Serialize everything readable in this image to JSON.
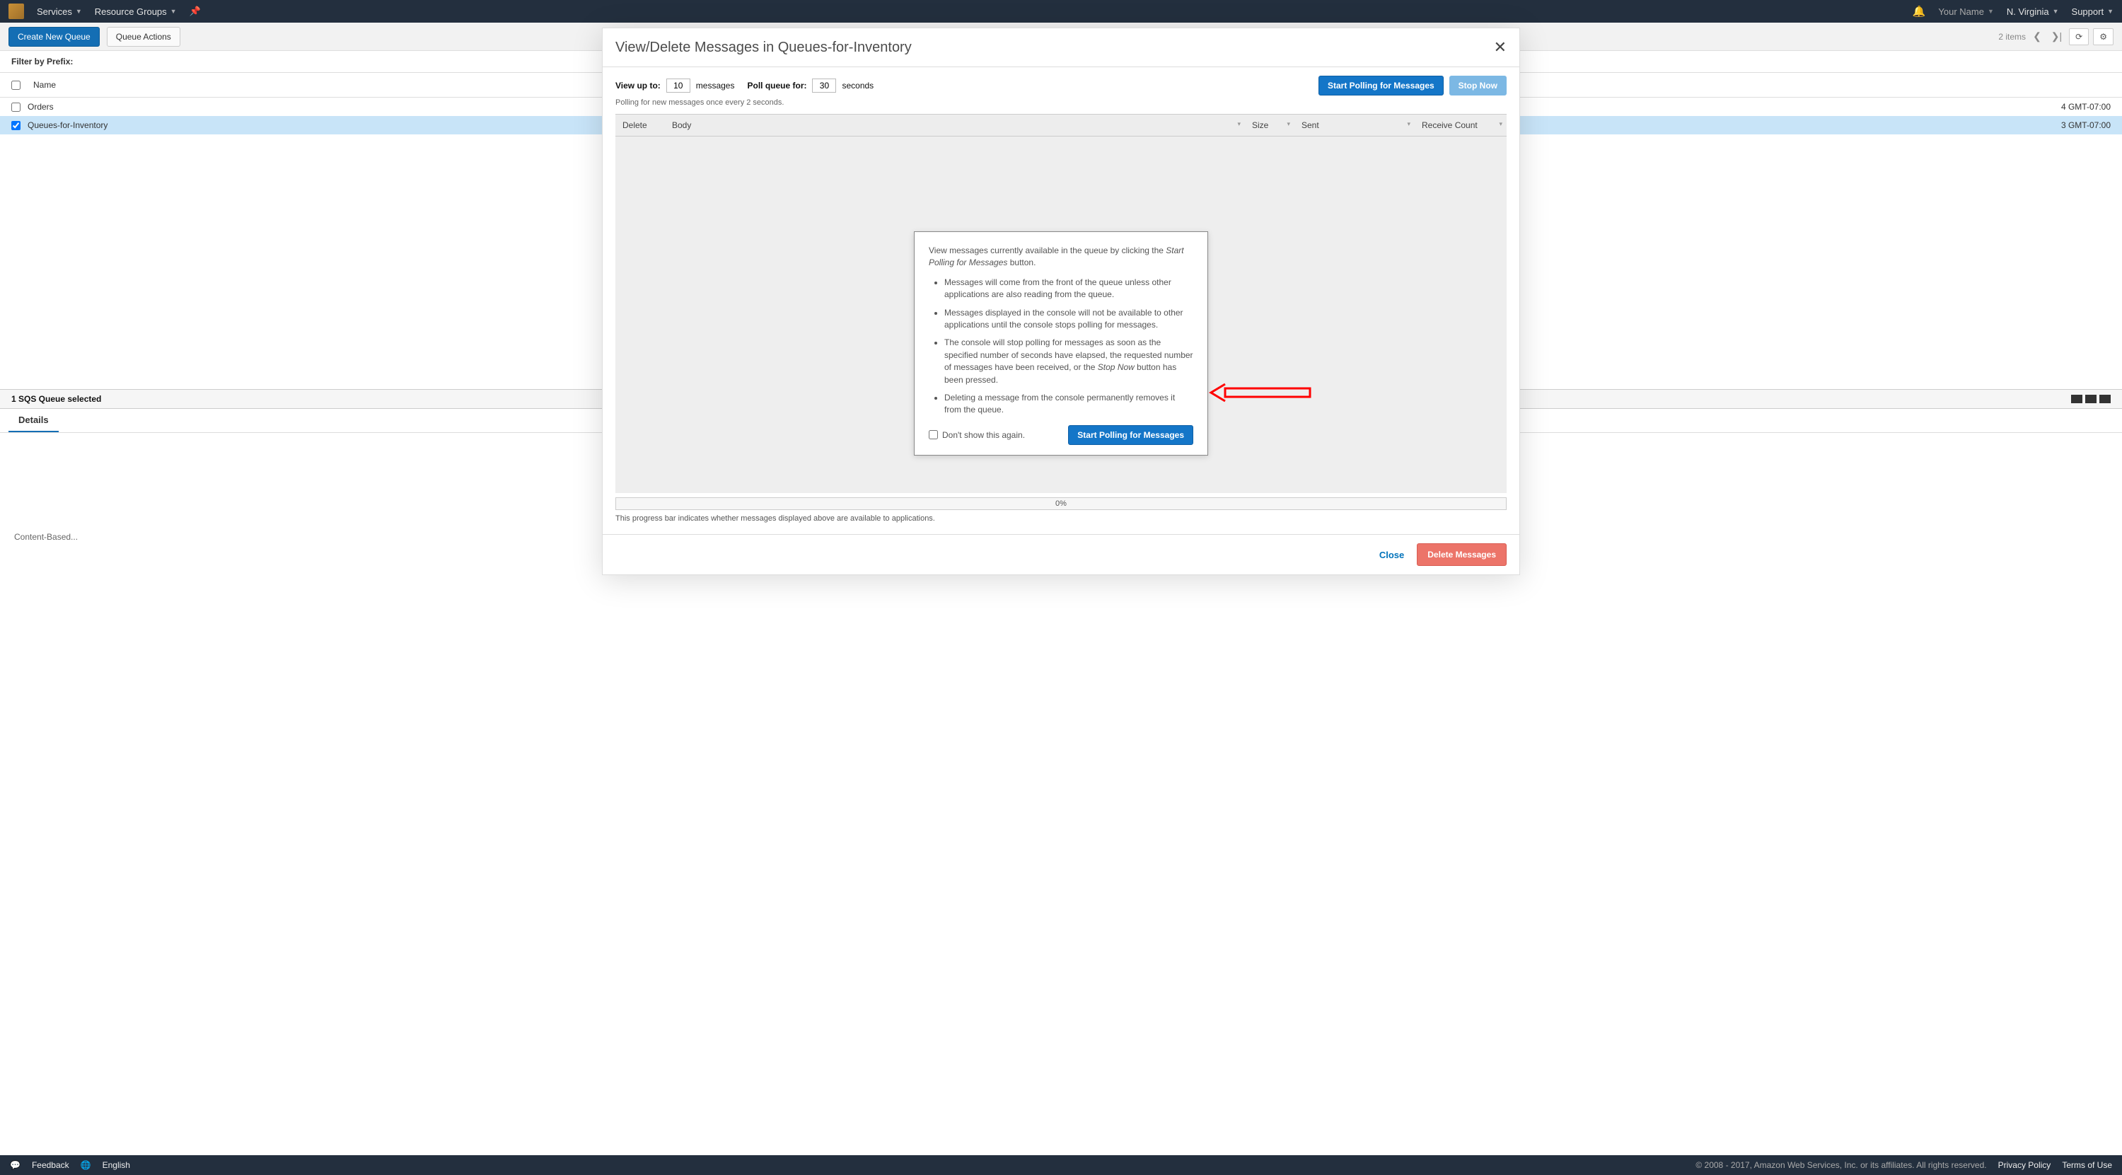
{
  "topnav": {
    "services": "Services",
    "resource_groups": "Resource Groups",
    "username": "Your Name",
    "region": "N. Virginia",
    "support": "Support"
  },
  "toolbar": {
    "create": "Create New Queue",
    "actions": "Queue Actions",
    "items_label": "2 items"
  },
  "list": {
    "filter_label": "Filter by Prefix:",
    "col_name": "Name",
    "rows": [
      {
        "name": "Orders",
        "ts": "4 GMT-07:00"
      },
      {
        "name": "Queues-for-Inventory",
        "ts": "3 GMT-07:00"
      }
    ]
  },
  "split": {
    "title": "1 SQS Queue selected",
    "tab_details": "Details",
    "content_ba": "Content-Based..."
  },
  "footer": {
    "feedback": "Feedback",
    "english": "English",
    "copyright": "© 2008 - 2017, Amazon Web Services, Inc. or its affiliates. All rights reserved.",
    "privacy": "Privacy Policy",
    "terms": "Terms of Use"
  },
  "modal": {
    "title": "View/Delete Messages in Queues-for-Inventory",
    "view_up_to_label": "View up to:",
    "view_up_to_value": "10",
    "messages_word": "messages",
    "poll_label": "Poll queue for:",
    "poll_value": "30",
    "seconds_word": "seconds",
    "start_polling": "Start Polling for Messages",
    "stop_now": "Stop Now",
    "subnote": "Polling for new messages once every 2 seconds.",
    "cols": {
      "delete": "Delete",
      "body": "Body",
      "size": "Size",
      "sent": "Sent",
      "rc": "Receive Count"
    },
    "info": {
      "intro_pre": "View messages currently available in the queue by clicking the ",
      "intro_em": "Start Polling for Messages",
      "intro_post": " button.",
      "li1": "Messages will come from the front of the queue unless other applications are also reading from the queue.",
      "li2": "Messages displayed in the console will not be available to other applications until the console stops polling for messages.",
      "li3_pre": "The console will stop polling for messages as soon as the specified number of seconds have elapsed, the requested number of messages have been received, or the ",
      "li3_em": "Stop Now",
      "li3_post": " button has been pressed.",
      "li4": "Deleting a message from the console permanently removes it from the queue.",
      "dontshow": "Don't show this again.",
      "start": "Start Polling for Messages"
    },
    "progress_pct": "0%",
    "progress_note": "This progress bar indicates whether messages displayed above are available to applications.",
    "close": "Close",
    "delete_messages": "Delete Messages"
  }
}
